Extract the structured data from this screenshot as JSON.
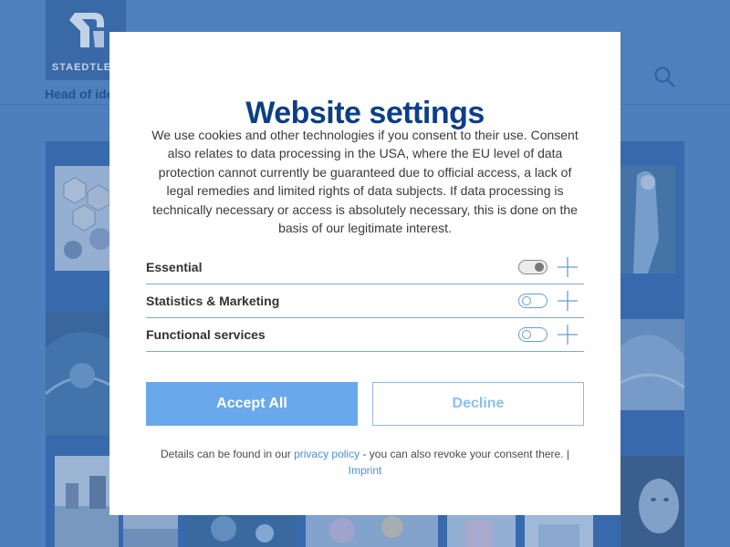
{
  "background": {
    "logo_text": "STAEDTLER",
    "tagline": "Head of ide"
  },
  "modal": {
    "title": "Website settings",
    "description": "We use cookies and other technologies if you consent to their use. Consent also relates to data processing in the USA, where the EU level of data protection cannot currently be guaranteed due to official access, a lack of legal remedies and limited rights of data subjects. If data processing is technically necessary or access is absolutely necessary, this is done on the basis of our legitimate interest.",
    "settings": [
      {
        "label": "Essential",
        "enabled": true,
        "locked": true
      },
      {
        "label": "Statistics & Marketing",
        "enabled": false,
        "locked": false
      },
      {
        "label": "Functional services",
        "enabled": false,
        "locked": false
      }
    ],
    "accept_label": "Accept All",
    "decline_label": "Decline",
    "footer": {
      "text_before": "Details can be found in our ",
      "privacy_link": "privacy policy",
      "text_after": " - you can also revoke your consent there. |",
      "imprint_link": "Imprint"
    }
  },
  "colors": {
    "accent": "#0c3f86",
    "accept_bg": "#6aa8ec",
    "link": "#4a90d9",
    "divider": "#7fa8d6"
  },
  "icons": {
    "search": "search-icon",
    "expand": "plus-icon",
    "logo": "staedtler-logo-icon"
  }
}
